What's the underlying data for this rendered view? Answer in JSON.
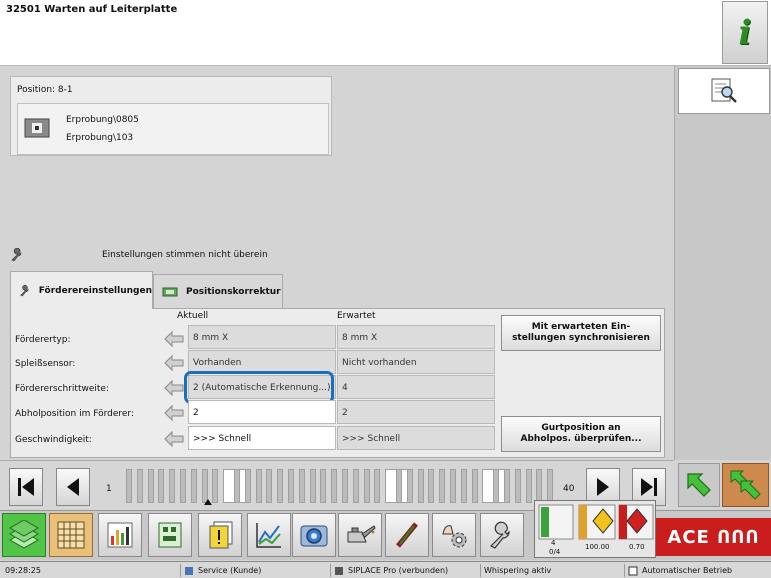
{
  "window": {
    "title": "32501 Warten auf Leiterplatte",
    "info_label": "i"
  },
  "position": {
    "label": "Position: 8-1",
    "feeder_lines": [
      "Erprobung\\0805",
      "Erprobung\\103"
    ]
  },
  "warning": {
    "text": "Einstellungen stimmen nicht überein",
    "icon": "wrench-icon"
  },
  "tabs": [
    {
      "label": "Förderereinstellungen",
      "icon": "wrench-icon",
      "active": true
    },
    {
      "label": "Positionskorrektur",
      "icon": "board-icon",
      "active": false
    }
  ],
  "settings": {
    "header_actual": "Aktuell",
    "header_expected": "Erwartet",
    "rows": [
      {
        "label": "Förderertyp:",
        "actual": "8 mm X",
        "expected": "8 mm X"
      },
      {
        "label": "Spleißsensor:",
        "actual": "Vorhanden",
        "expected": "Nicht vorhanden"
      },
      {
        "label": "Fördererschrittweite:",
        "actual": "2 (Automatische Erkennung...)",
        "expected": "4"
      },
      {
        "label": "Abholposition im Förderer:",
        "actual": "2",
        "expected": "2"
      },
      {
        "label": "Geschwindigkeit:",
        "actual": ">>> Schnell",
        "expected": ">>> Schnell"
      }
    ],
    "sync_button": [
      "Mit erwarteten Ein-",
      "stellungen synchronisieren"
    ],
    "check_button": [
      "Gurtposition an",
      "Abholpos. überprüfen..."
    ]
  },
  "navigator": {
    "first_slot": "1",
    "last_slot": "40"
  },
  "status_widget": {
    "count": "4",
    "ratio": "0/4",
    "value_a": "100.00",
    "value_b": "0.70",
    "bars": [
      "100",
      "80",
      "60",
      "40",
      "20",
      "0"
    ]
  },
  "logo_text": "ACE ՈՈՈ",
  "status_bar": {
    "time": "09:28:25",
    "user": "Service (Kunde)",
    "connection": "SIPLACE Pro (verbunden)",
    "whisper": "Whispering aktiv",
    "mode": "Automatischer Betrieb"
  },
  "colors": {
    "accent_blue": "#1b6ebc",
    "logo_red": "#ca1e1e",
    "green_tool": "#52c447",
    "orange_tool": "#ce8a4e"
  }
}
